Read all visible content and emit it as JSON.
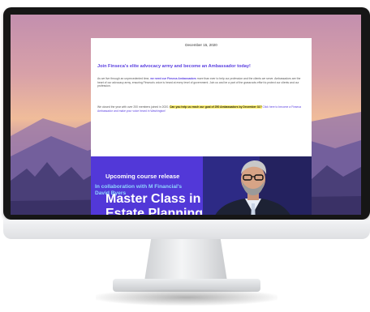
{
  "email": {
    "date": "December 15, 2020",
    "headline": "Join Finseca's elite advocacy army and become an Ambassador today!",
    "paragraph1": {
      "intro": "As we live through an unprecedented time, ",
      "bold": "we need our Finseca Ambassadors",
      "rest": " more than ever to help our profession and the clients we serve. Ambassadors are the heart of our advocacy army, ensuring Finseca's voice is heard at every level of government. Join us and be a part of the grassroots effort to protect our clients and our profession."
    },
    "paragraph2": {
      "intro": "We closed the year with over 200 members joined in 2020. ",
      "highlight": "Can you help us reach our goal of 250 Ambassadors by December 31?",
      "rest": " Click here to become a Finseca Ambassador and make your voice heard in Washington!"
    }
  },
  "banner": {
    "subtitle": "Upcoming course release",
    "title_line1": "Master Class in",
    "title_line2": "Estate Planning",
    "collab_line1": "In collaboration with M Financial's",
    "collab_line2": "David Byers"
  },
  "colors": {
    "accent": "#5a3fe0",
    "banner_bg": "#5238d8",
    "collab_text": "#8fd6ff",
    "bezel": "#161616"
  }
}
